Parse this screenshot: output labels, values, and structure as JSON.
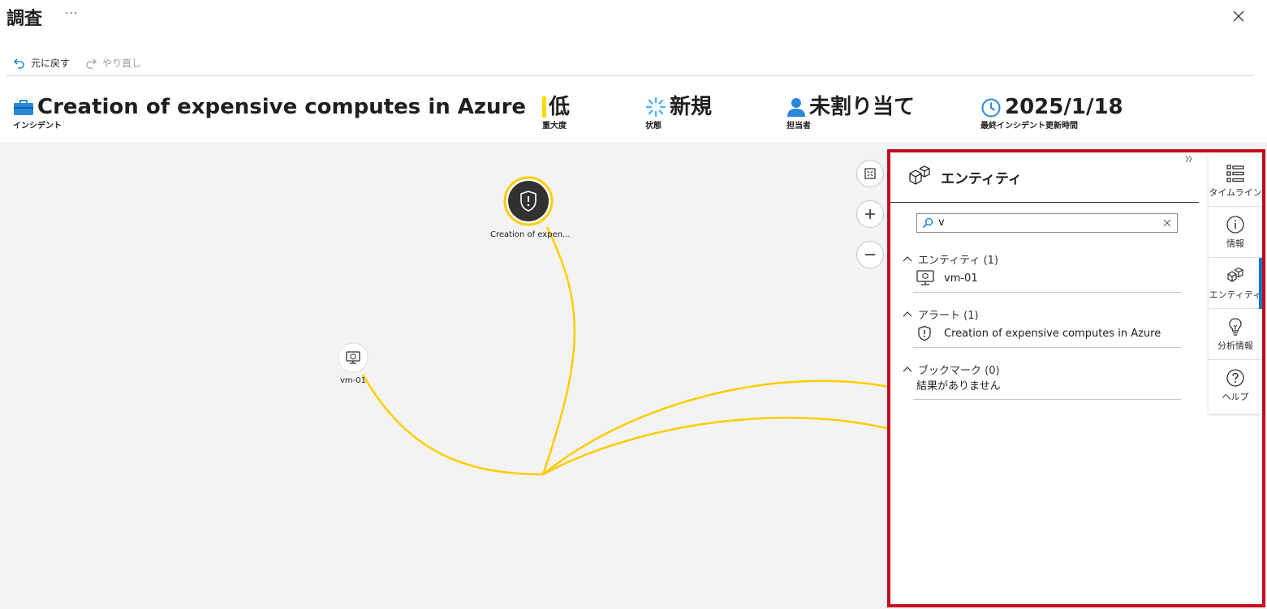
{
  "header": {
    "title": "調査",
    "more_label": "···"
  },
  "toolbar": {
    "undo_label": "元に戻す",
    "redo_label": "やり直し"
  },
  "incident": {
    "title": "Creation of expensive computes in Azure",
    "title_label": "インシデント",
    "severity_value": "低",
    "severity_label": "重大度",
    "severity_color": "#ffd800",
    "status_value": "新規",
    "status_label": "状態",
    "owner_value": "未割り当て",
    "owner_label": "担当者",
    "updated_value": "2025/1/18",
    "updated_label": "最終インシデント更新時間"
  },
  "graph": {
    "alert_node_label": "Creation of expen...",
    "vm_node_label": "vm-01",
    "edge_color": "#ffcc00"
  },
  "panel": {
    "title": "エンティティ",
    "search_value": "v",
    "sections": [
      {
        "header": "エンティティ (1)",
        "items": [
          "vm-01"
        ]
      },
      {
        "header": "アラート (1)",
        "items": [
          "Creation of expensive computes in Azure"
        ]
      },
      {
        "header": "ブックマーク (0)",
        "empty_text": "結果がありません"
      }
    ]
  },
  "rail": {
    "items": [
      {
        "label": "タイムライン",
        "icon": "timeline-icon"
      },
      {
        "label": "情報",
        "icon": "info-icon"
      },
      {
        "label": "エンティティ",
        "icon": "entities-icon"
      },
      {
        "label": "分析情報",
        "icon": "insights-icon"
      },
      {
        "label": "ヘルプ",
        "icon": "help-icon"
      }
    ],
    "active_index": 2
  },
  "colors": {
    "accent": "#0078d4",
    "highlight_border": "#c50f1f"
  }
}
